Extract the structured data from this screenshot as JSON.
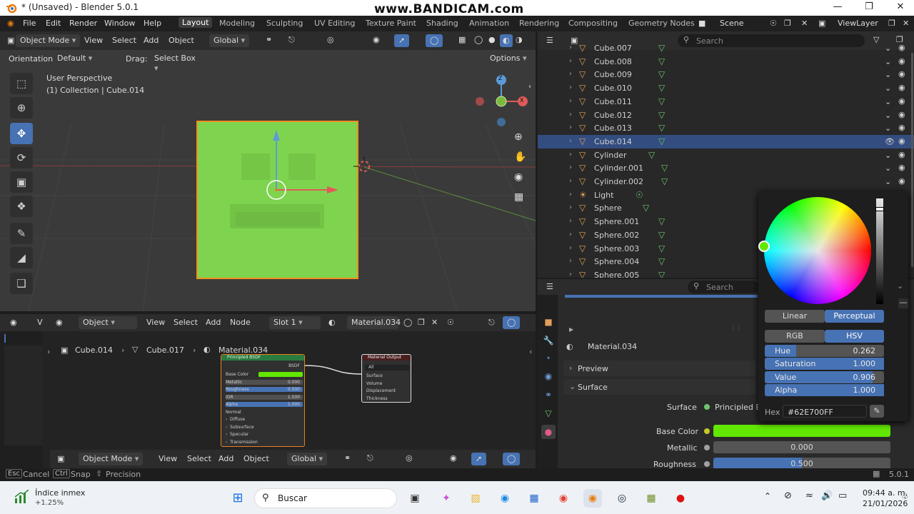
{
  "titlebar": {
    "title": "* (Unsaved) - Blender 5.0.1",
    "watermark": "www.BANDICAM.com"
  },
  "menu": [
    "File",
    "Edit",
    "Render",
    "Window",
    "Help"
  ],
  "workspaces": [
    "Layout",
    "Modeling",
    "Sculpting",
    "UV Editing",
    "Texture Paint",
    "Shading",
    "Animation",
    "Rendering",
    "Compositing",
    "Geometry Nodes"
  ],
  "scene": "Scene",
  "view_layer": "ViewLayer",
  "viewport": {
    "mode": "Object Mode",
    "menus": [
      "View",
      "Select",
      "Add",
      "Object"
    ],
    "transform": "Global",
    "orientation_label": "Orientation:",
    "orientation_value": "Default",
    "drag_label": "Drag:",
    "drag_value": "Select Box",
    "options": "Options",
    "overlay_line1": "User Perspective",
    "overlay_line2": "(1) Collection | Cube.014",
    "gizmo_z": "Z",
    "gizmo_x": "X"
  },
  "outliner": {
    "search_placeholder": "Search",
    "items": [
      {
        "name": "Cube.007",
        "type": "mesh"
      },
      {
        "name": "Cube.008",
        "type": "mesh"
      },
      {
        "name": "Cube.009",
        "type": "mesh"
      },
      {
        "name": "Cube.010",
        "type": "mesh"
      },
      {
        "name": "Cube.011",
        "type": "mesh"
      },
      {
        "name": "Cube.012",
        "type": "mesh"
      },
      {
        "name": "Cube.013",
        "type": "mesh"
      },
      {
        "name": "Cube.014",
        "type": "mesh",
        "selected": true
      },
      {
        "name": "Cylinder",
        "type": "mesh"
      },
      {
        "name": "Cylinder.001",
        "type": "mesh"
      },
      {
        "name": "Cylinder.002",
        "type": "mesh"
      },
      {
        "name": "Light",
        "type": "light"
      },
      {
        "name": "Sphere",
        "type": "mesh"
      },
      {
        "name": "Sphere.001",
        "type": "mesh"
      },
      {
        "name": "Sphere.002",
        "type": "mesh"
      },
      {
        "name": "Sphere.003",
        "type": "mesh"
      },
      {
        "name": "Sphere.004",
        "type": "mesh"
      },
      {
        "name": "Sphere.005",
        "type": "mesh"
      }
    ]
  },
  "properties": {
    "search_placeholder": "Search",
    "material": "Material.034",
    "preview": "Preview",
    "surface_section": "Surface",
    "surface_label": "Surface",
    "surface_value": "Principled B",
    "base_color_label": "Base Color",
    "base_color": "#62E700",
    "metallic_label": "Metallic",
    "metallic_value": "0.000",
    "roughness_label": "Roughness",
    "roughness_value": "0.500"
  },
  "picker": {
    "linear": "Linear",
    "perceptual": "Perceptual",
    "rgb": "RGB",
    "hsv": "HSV",
    "hue_label": "Hue",
    "hue": "0.262",
    "sat_label": "Saturation",
    "sat": "1.000",
    "val_label": "Value",
    "val": "0.906",
    "alpha_label": "Alpha",
    "alpha": "1.000",
    "hex_label": "Hex",
    "hex": "#62E700FF",
    "hue_fraction": 0.262,
    "sat_fraction": 1.0,
    "value_fraction": 0.906,
    "alpha_fraction": 1.0
  },
  "node_editor": {
    "type": "Object",
    "menus": [
      "View",
      "Select",
      "Add",
      "Node"
    ],
    "slot": "Slot 1",
    "material": "Material.034",
    "breadcrumb": [
      "Cube.014",
      "Cube.017",
      "Material.034"
    ],
    "bsdf_title": "Principled BSDF",
    "bsdf_out": "BSDF",
    "bsdf_rows": [
      "Base Color",
      "Metallic",
      "Roughness",
      "IOR",
      "Alpha",
      "Normal",
      "Diffuse",
      "Subsurface",
      "Specular",
      "Transmission"
    ],
    "bsdf_values": [
      "",
      "0.000",
      "0.500",
      "1.500",
      "1.000"
    ],
    "output_title": "Material Output",
    "output_target": "All",
    "output_rows": [
      "Surface",
      "Volume",
      "Displacement",
      "Thickness"
    ]
  },
  "bottom_viewport": {
    "mode": "Object Mode",
    "menus": [
      "View",
      "Select",
      "Add",
      "Object"
    ],
    "transform": "Global"
  },
  "statusbar": {
    "k1": "Esc",
    "a1": "Cancel",
    "k2": "Ctrl",
    "a2": "Snap",
    "a3": "Precision",
    "version": "5.0.1"
  },
  "taskbar": {
    "widget_title": "Índice inmex",
    "widget_value": "+1.25%",
    "search": "Buscar",
    "time": "09:44 a. m.",
    "date": "21/01/2026"
  },
  "colors": {
    "accent": "#4772b3",
    "selected_row": "#334d80",
    "mesh_green": "#62E700"
  }
}
